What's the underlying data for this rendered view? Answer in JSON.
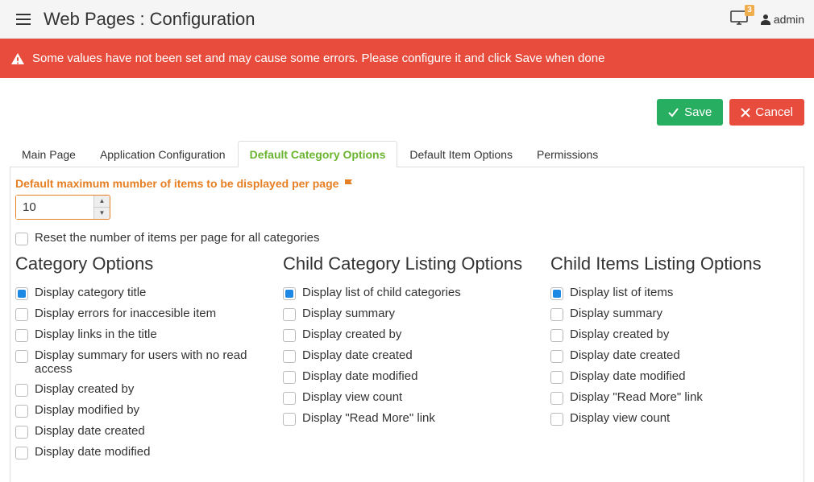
{
  "header": {
    "title": "Web Pages : Configuration",
    "badge_count": "3",
    "user": "admin"
  },
  "alert": {
    "text": "Some values have not been set and may cause some errors. Please configure it and click Save when done"
  },
  "actions": {
    "save": "Save",
    "cancel": "Cancel"
  },
  "tabs": [
    {
      "label": "Main Page",
      "active": false
    },
    {
      "label": "Application Configuration",
      "active": false
    },
    {
      "label": "Default Category Options",
      "active": true
    },
    {
      "label": "Default Item Options",
      "active": false
    },
    {
      "label": "Permissions",
      "active": false
    }
  ],
  "field": {
    "label": "Default maximum mumber of items to be displayed per page",
    "value": "10",
    "reset_label": "Reset the number of items per page for all categories"
  },
  "columns": {
    "category": {
      "title": "Category Options",
      "items": [
        {
          "label": "Display category title",
          "checked": true
        },
        {
          "label": "Display errors for inaccesible item",
          "checked": false
        },
        {
          "label": "Display links in the title",
          "checked": false
        },
        {
          "label": "Display summary for users with no read access",
          "checked": false
        },
        {
          "label": "Display created by",
          "checked": false
        },
        {
          "label": "Display modified by",
          "checked": false
        },
        {
          "label": "Display date created",
          "checked": false
        },
        {
          "label": "Display date modified",
          "checked": false
        }
      ]
    },
    "child_cat": {
      "title": "Child Category Listing Options",
      "items": [
        {
          "label": "Display list of child categories",
          "checked": true
        },
        {
          "label": "Display summary",
          "checked": false
        },
        {
          "label": "Display created by",
          "checked": false
        },
        {
          "label": "Display date created",
          "checked": false
        },
        {
          "label": "Display date modified",
          "checked": false
        },
        {
          "label": "Display view count",
          "checked": false
        },
        {
          "label": "Display \"Read More\" link",
          "checked": false
        }
      ]
    },
    "child_items": {
      "title": "Child Items Listing Options",
      "items": [
        {
          "label": "Display list of items",
          "checked": true
        },
        {
          "label": "Display summary",
          "checked": false
        },
        {
          "label": "Display created by",
          "checked": false
        },
        {
          "label": "Display date created",
          "checked": false
        },
        {
          "label": "Display date modified",
          "checked": false
        },
        {
          "label": "Display \"Read More\" link",
          "checked": false
        },
        {
          "label": "Display view count",
          "checked": false
        }
      ]
    }
  }
}
